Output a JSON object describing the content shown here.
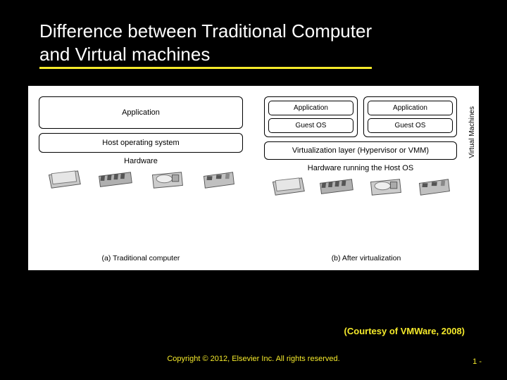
{
  "slide": {
    "title_line1": "Difference between Traditional Computer",
    "title_line2": "and Virtual machines"
  },
  "diagram": {
    "panel_a": {
      "application": "Application",
      "host_os": "Host operating system",
      "hardware": "Hardware",
      "caption": "(a) Traditional computer"
    },
    "panel_b": {
      "vm_label": "Virtual Machines",
      "vm1_app": "Application",
      "vm1_os": "Guest OS",
      "vm2_app": "Application",
      "vm2_os": "Guest OS",
      "virt_layer": "Virtualization layer (Hypervisor or VMM)",
      "hardware": "Hardware running the Host OS",
      "caption": "(b) After virtualization"
    }
  },
  "credit": "(Courtesy of VMWare, 2008)",
  "copyright": "Copyright © 2012, Elsevier Inc. All rights reserved.",
  "page_number": "1 -",
  "colors": {
    "accent": "#f5ea2b"
  }
}
